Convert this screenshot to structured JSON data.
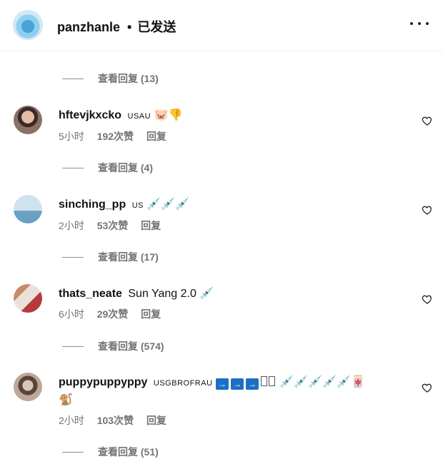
{
  "header": {
    "username": "panzhanle",
    "separator": "•",
    "status": "已发送"
  },
  "replies": [
    "查看回复 (13)",
    "查看回复 (4)",
    "查看回复 (17)",
    "查看回复 (574)",
    "查看回复 (51)"
  ],
  "comments": [
    {
      "username": "hftevjkxcko",
      "text": "USAU",
      "emojis": "🐷👎",
      "time": "5小时",
      "likes": "192次赞",
      "reply": "回复"
    },
    {
      "username": "sinching_pp",
      "text": "US",
      "emojis": "💉💉💉",
      "time": "2小时",
      "likes": "53次赞",
      "reply": "回复"
    },
    {
      "username": "thats_neate",
      "text": "Sun Yang 2.0",
      "emojis": "💉",
      "time": "6小时",
      "likes": "29次赞",
      "reply": "回复"
    },
    {
      "username": "puppypuppyppy",
      "text": "USGBROFRAU",
      "arrows": "→",
      "emojis": "💉💉💉💉💉🀄",
      "emojis2": "🐒",
      "time": "2小时",
      "likes": "103次赞",
      "reply": "回复"
    }
  ],
  "icons": {
    "more": "more-options-icon",
    "heart": "heart-outline-icon"
  }
}
